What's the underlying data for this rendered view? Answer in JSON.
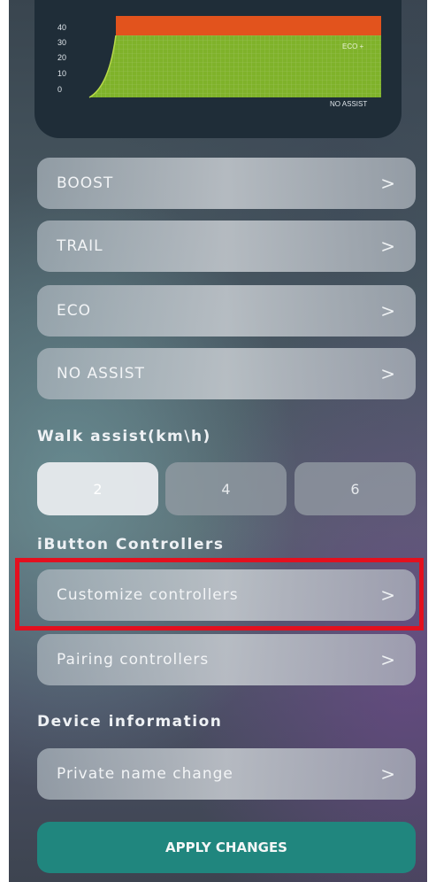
{
  "chart_data": {
    "type": "area",
    "y_ticks": [
      "40",
      "30",
      "20",
      "10",
      "0"
    ],
    "series": [
      {
        "name": "ECO +",
        "color": "#7fb22a"
      },
      {
        "name": "NO ASSIST",
        "color": "#7fb22a"
      }
    ],
    "boost_color": "#e2531d"
  },
  "modes": [
    {
      "label": "BOOST"
    },
    {
      "label": "TRAIL"
    },
    {
      "label": "ECO"
    },
    {
      "label": "NO ASSIST"
    }
  ],
  "walk_assist": {
    "title": "Walk assist(km\\h)",
    "options": [
      "2",
      "4",
      "6"
    ],
    "selected": "2"
  },
  "ibutton": {
    "title": "iButton Controllers",
    "items": [
      {
        "label": "Customize controllers"
      },
      {
        "label": "Pairing controllers"
      }
    ]
  },
  "device": {
    "title": "Device information",
    "items": [
      {
        "label": "Private name change"
      }
    ]
  },
  "apply_label": "APPLY CHANGES",
  "chevron": ">",
  "colors": {
    "accent": "#20867e",
    "highlight": "#e3101f"
  }
}
